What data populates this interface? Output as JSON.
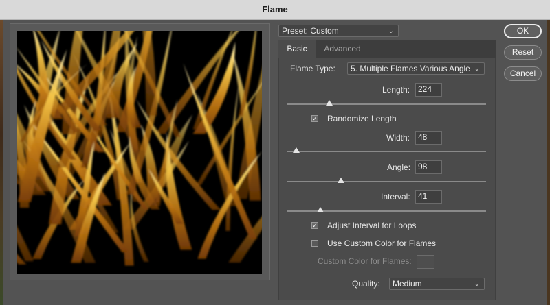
{
  "window": {
    "title": "Flame"
  },
  "preset": {
    "label": "Preset: Custom"
  },
  "tabs": [
    {
      "label": "Basic"
    },
    {
      "label": "Advanced"
    }
  ],
  "flame_type": {
    "label": "Flame Type:",
    "value": "5. Multiple Flames Various Angle"
  },
  "length": {
    "label": "Length:",
    "value": "224",
    "slider_fraction": 0.21
  },
  "randomize_length": {
    "label": "Randomize Length",
    "checked": true
  },
  "width": {
    "label": "Width:",
    "value": "48",
    "slider_fraction": 0.045
  },
  "angle": {
    "label": "Angle:",
    "value": "98",
    "slider_fraction": 0.27
  },
  "interval": {
    "label": "Interval:",
    "value": "41",
    "slider_fraction": 0.165
  },
  "adjust_interval": {
    "label": "Adjust Interval for Loops",
    "checked": true
  },
  "use_custom_color": {
    "label": "Use Custom Color for Flames",
    "checked": false
  },
  "custom_color": {
    "label": "Custom Color for Flames:"
  },
  "quality": {
    "label": "Quality:",
    "value": "Medium"
  },
  "buttons": {
    "ok": "OK",
    "reset": "Reset",
    "cancel": "Cancel"
  },
  "colors": {
    "flame_core": "#fff6c8",
    "flame_mid": "#f6c84a",
    "flame_edge": "#c27a14",
    "accent": "#ececec"
  }
}
